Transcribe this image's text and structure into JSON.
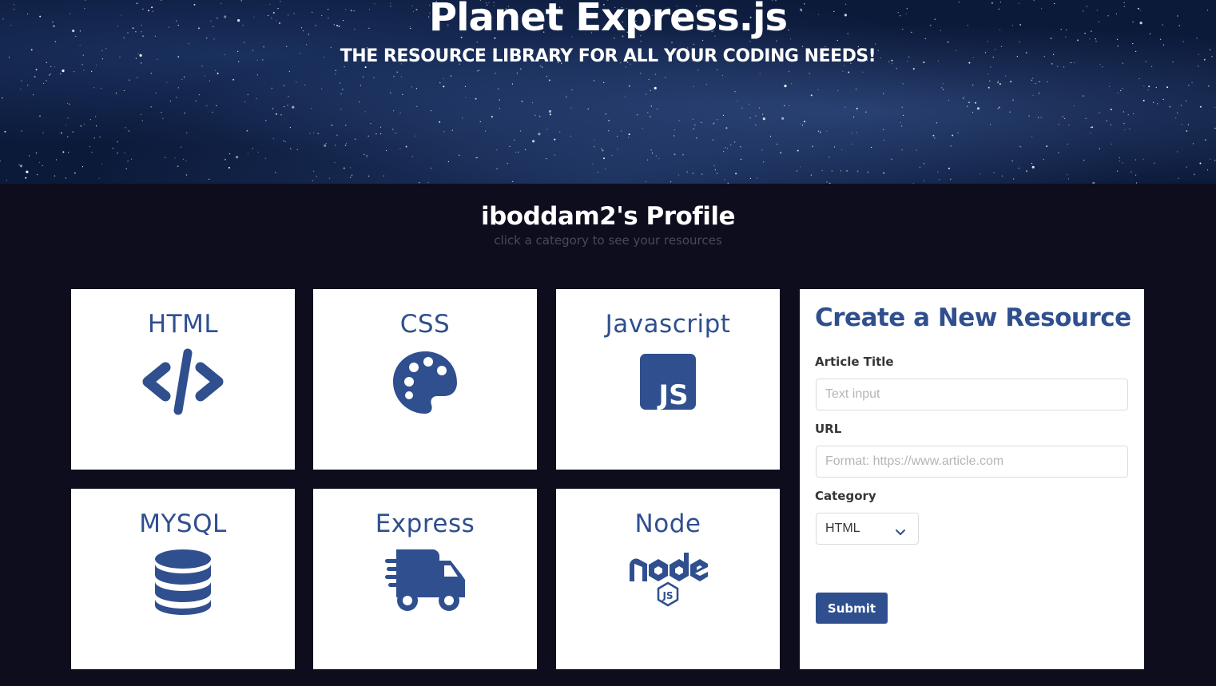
{
  "header": {
    "title": "Planet Express.js",
    "subtitle": "THE RESOURCE LIBRARY FOR ALL YOUR CODING NEEDS!"
  },
  "profile": {
    "title": "iboddam2's Profile",
    "subtitle": "click a category to see your resources"
  },
  "categories": [
    {
      "label": "HTML",
      "icon": "code-icon"
    },
    {
      "label": "CSS",
      "icon": "palette-icon"
    },
    {
      "label": "Javascript",
      "icon": "js-icon"
    },
    {
      "label": "MYSQL",
      "icon": "database-icon"
    },
    {
      "label": "Express",
      "icon": "truck-fast-icon"
    },
    {
      "label": "Node",
      "icon": "nodejs-icon"
    }
  ],
  "form": {
    "title": "Create a New Resource",
    "article_title_label": "Article Title",
    "article_title_placeholder": "Text input",
    "article_title_value": "",
    "url_label": "URL",
    "url_placeholder": "Format: https://www.article.com",
    "url_value": "",
    "category_label": "Category",
    "category_selected": "HTML",
    "submit_label": "Submit"
  },
  "colors": {
    "accent": "#2f4f8f",
    "page_background": "#0e0d1e",
    "card_background": "#ffffff"
  }
}
